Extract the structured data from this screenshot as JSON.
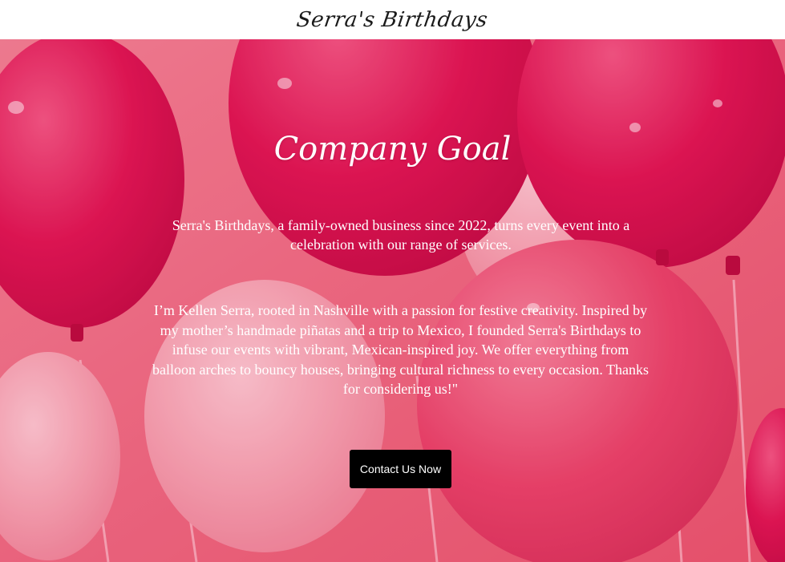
{
  "header": {
    "logo_text": "Serra's Birthdays"
  },
  "hero": {
    "title": "Company Goal",
    "intro": "Serra's Birthdays, a family-owned business since 2022, turns every event into a celebration with our range of services.",
    "bio": "I’m Kellen Serra, rooted in Nashville with a passion for festive creativity. Inspired by my mother’s handmade piñatas and a trip to Mexico, I founded Serra's Birthdays to infuse our events with vibrant, Mexican-inspired joy. We offer everything from balloon arches to bouncy houses, bringing cultural richness to every occasion. Thanks for considering us!\"",
    "cta_label": "Contact Us Now",
    "background_image": "pink-balloons"
  },
  "colors": {
    "header_bg": "#ffffff",
    "hero_base": "#e8576f",
    "balloon_deep": "#d7104f",
    "balloon_light": "#f3a0ad",
    "button_bg": "#000000",
    "text_light": "#ffffff"
  }
}
